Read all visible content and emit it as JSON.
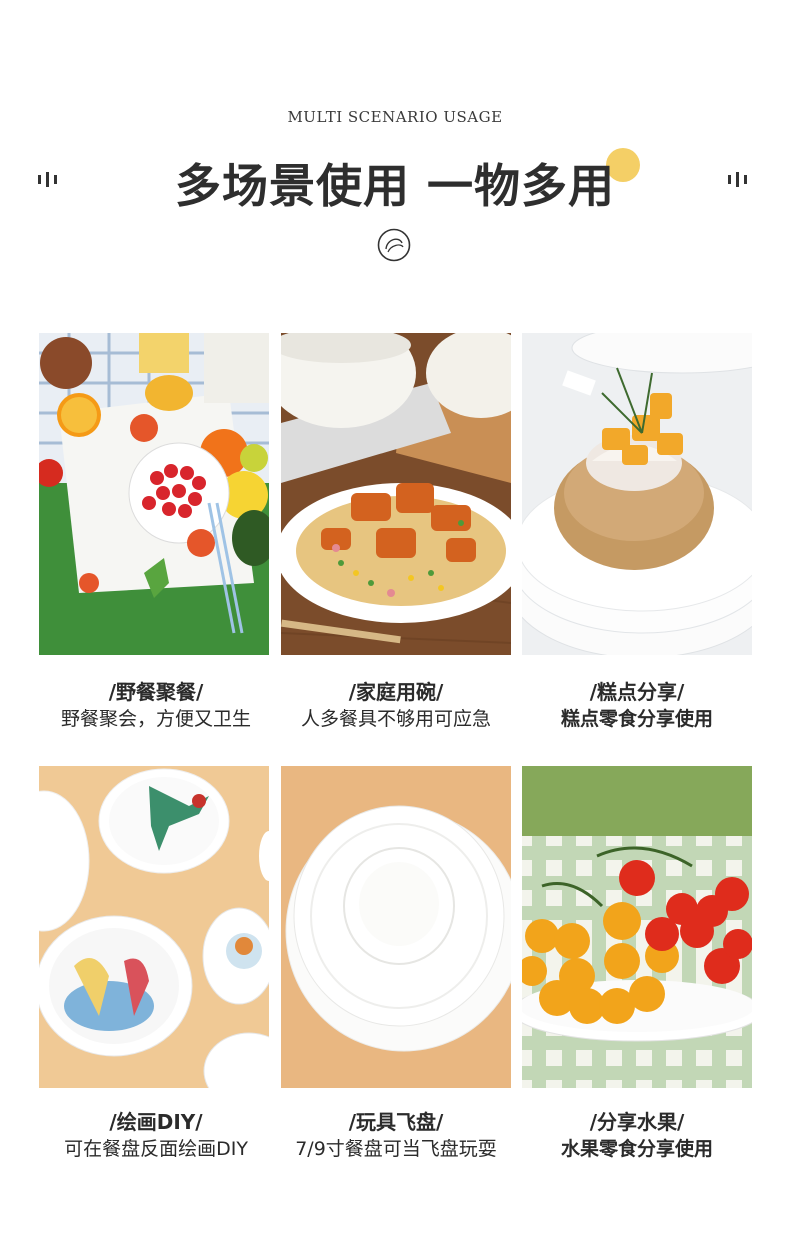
{
  "header": {
    "subtitle": "MULTI SCENARIO USAGE",
    "headline": "多场景使用 一物多用"
  },
  "colors": {
    "accent": "#f4cf66",
    "text": "#2b2b2b"
  },
  "scenarios": [
    {
      "title": "/野餐聚餐/",
      "desc": "野餐聚会，方便又卫生",
      "photo": "picnic-photo"
    },
    {
      "title": "/家庭用碗/",
      "desc": "人多餐具不够用可应急",
      "photo": "fried-rice-photo"
    },
    {
      "title": "/糕点分享/",
      "desc": "糕点零食分享使用",
      "photo": "pastry-photo"
    },
    {
      "title": "/绘画DIY/",
      "desc": "可在餐盘反面绘画DIY",
      "photo": "painted-plates-photo"
    },
    {
      "title": "/玩具飞盘/",
      "desc": "7/9寸餐盘可当飞盘玩耍",
      "photo": "bowl-frisbee-photo"
    },
    {
      "title": "/分享水果/",
      "desc": "水果零食分享使用",
      "photo": "tomatoes-photo"
    }
  ]
}
